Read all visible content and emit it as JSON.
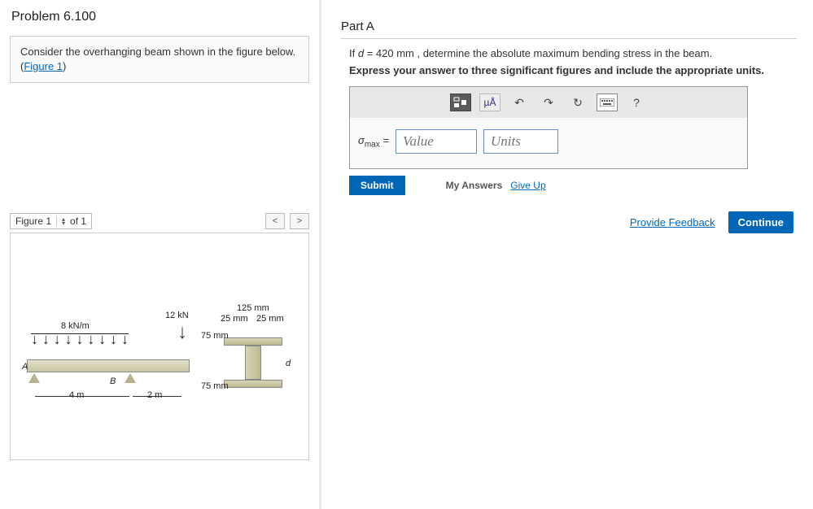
{
  "problem": {
    "title": "Problem 6.100",
    "statement_pre": "Consider the overhanging beam shown in the figure below. (",
    "figure_link": "Figure 1",
    "statement_post": ")"
  },
  "figure": {
    "selector_label": "Figure 1",
    "count_label": "of 1",
    "prev": "<",
    "next": ">",
    "labels": {
      "load_dist": "8 kN/m",
      "load_point": "12 kN",
      "span1": "4 m",
      "span2": "2 m",
      "ptA": "A",
      "ptB": "B",
      "cs_125": "125 mm",
      "cs_25a": "25 mm",
      "cs_25b": "25 mm",
      "cs_75a": "75 mm",
      "cs_75b": "75 mm",
      "cs_d": "d"
    }
  },
  "partA": {
    "title": "Part A",
    "question_pre": "If ",
    "question_var": "d",
    "question_eq": " = 420 mm , determine the absolute maximum bending stress in the beam.",
    "instruction": "Express your answer to three significant figures and include the appropriate units.",
    "toolbar": {
      "templates": "▭",
      "ua": "µÅ",
      "undo": "↶",
      "redo": "↷",
      "reset": "↻",
      "keyboard": "⌨",
      "help": "?"
    },
    "sigma": "σ",
    "sigma_sub": "max",
    "equals": "=",
    "value_placeholder": "Value",
    "units_placeholder": "Units",
    "submit": "Submit",
    "my_answers": "My Answers",
    "give_up": "Give Up"
  },
  "footer": {
    "feedback": "Provide Feedback",
    "continue": "Continue"
  }
}
